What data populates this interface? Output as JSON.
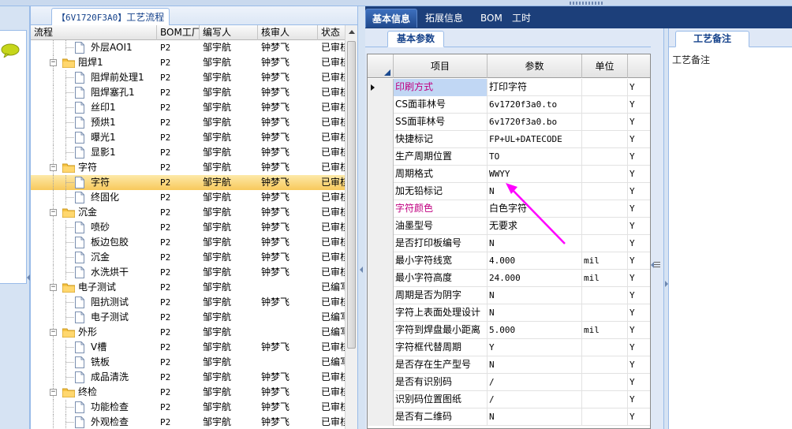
{
  "tree_panel": {
    "tab_code": "【6V1720F3A0】",
    "tab_title": "工艺流程",
    "columns": {
      "name": "流程",
      "bom": "BOM工厂",
      "author": "编写人",
      "reviewer": "核审人",
      "status": "状态"
    },
    "rows": [
      {
        "name": "外层AOI1",
        "bom": "P2",
        "author": "邹宇航",
        "reviewer": "钟梦飞",
        "status": "已审核",
        "level": 2,
        "type": "doc"
      },
      {
        "name": "阻焊1",
        "bom": "P2",
        "author": "邹宇航",
        "reviewer": "钟梦飞",
        "status": "已审核",
        "level": 1,
        "type": "folder"
      },
      {
        "name": "阻焊前处理1",
        "bom": "P2",
        "author": "邹宇航",
        "reviewer": "钟梦飞",
        "status": "已审核",
        "level": 2,
        "type": "doc"
      },
      {
        "name": "阻焊塞孔1",
        "bom": "P2",
        "author": "邹宇航",
        "reviewer": "钟梦飞",
        "status": "已审核",
        "level": 2,
        "type": "doc"
      },
      {
        "name": "丝印1",
        "bom": "P2",
        "author": "邹宇航",
        "reviewer": "钟梦飞",
        "status": "已审核",
        "level": 2,
        "type": "doc"
      },
      {
        "name": "预烘1",
        "bom": "P2",
        "author": "邹宇航",
        "reviewer": "钟梦飞",
        "status": "已审核",
        "level": 2,
        "type": "doc"
      },
      {
        "name": "曝光1",
        "bom": "P2",
        "author": "邹宇航",
        "reviewer": "钟梦飞",
        "status": "已审核",
        "level": 2,
        "type": "doc"
      },
      {
        "name": "显影1",
        "bom": "P2",
        "author": "邹宇航",
        "reviewer": "钟梦飞",
        "status": "已审核",
        "level": 2,
        "type": "doc"
      },
      {
        "name": "字符",
        "bom": "P2",
        "author": "邹宇航",
        "reviewer": "钟梦飞",
        "status": "已审核",
        "level": 1,
        "type": "folder"
      },
      {
        "name": "字符",
        "bom": "P2",
        "author": "邹宇航",
        "reviewer": "钟梦飞",
        "status": "已审核",
        "level": 2,
        "type": "doc",
        "selected": true
      },
      {
        "name": "终固化",
        "bom": "P2",
        "author": "邹宇航",
        "reviewer": "钟梦飞",
        "status": "已审核",
        "level": 2,
        "type": "doc"
      },
      {
        "name": "沉金",
        "bom": "P2",
        "author": "邹宇航",
        "reviewer": "钟梦飞",
        "status": "已审核",
        "level": 1,
        "type": "folder"
      },
      {
        "name": "喷砂",
        "bom": "P2",
        "author": "邹宇航",
        "reviewer": "钟梦飞",
        "status": "已审核",
        "level": 2,
        "type": "doc"
      },
      {
        "name": "板边包胶",
        "bom": "P2",
        "author": "邹宇航",
        "reviewer": "钟梦飞",
        "status": "已审核",
        "level": 2,
        "type": "doc"
      },
      {
        "name": "沉金",
        "bom": "P2",
        "author": "邹宇航",
        "reviewer": "钟梦飞",
        "status": "已审核",
        "level": 2,
        "type": "doc"
      },
      {
        "name": "水洗烘干",
        "bom": "P2",
        "author": "邹宇航",
        "reviewer": "钟梦飞",
        "status": "已审核",
        "level": 2,
        "type": "doc"
      },
      {
        "name": "电子测试",
        "bom": "P2",
        "author": "邹宇航",
        "reviewer": "",
        "status": "已编写",
        "level": 1,
        "type": "folder"
      },
      {
        "name": "阻抗测试",
        "bom": "P2",
        "author": "邹宇航",
        "reviewer": "钟梦飞",
        "status": "已审核",
        "level": 2,
        "type": "doc"
      },
      {
        "name": "电子测试",
        "bom": "P2",
        "author": "邹宇航",
        "reviewer": "",
        "status": "已编写",
        "level": 2,
        "type": "doc"
      },
      {
        "name": "外形",
        "bom": "P2",
        "author": "邹宇航",
        "reviewer": "",
        "status": "已编写",
        "level": 1,
        "type": "folder"
      },
      {
        "name": "V槽",
        "bom": "P2",
        "author": "邹宇航",
        "reviewer": "钟梦飞",
        "status": "已审核",
        "level": 2,
        "type": "doc"
      },
      {
        "name": "铣板",
        "bom": "P2",
        "author": "邹宇航",
        "reviewer": "",
        "status": "已编写",
        "level": 2,
        "type": "doc"
      },
      {
        "name": "成品清洗",
        "bom": "P2",
        "author": "邹宇航",
        "reviewer": "钟梦飞",
        "status": "已审核",
        "level": 2,
        "type": "doc"
      },
      {
        "name": "终检",
        "bom": "P2",
        "author": "邹宇航",
        "reviewer": "钟梦飞",
        "status": "已审核",
        "level": 1,
        "type": "folder"
      },
      {
        "name": "功能检查",
        "bom": "P2",
        "author": "邹宇航",
        "reviewer": "钟梦飞",
        "status": "已审核",
        "level": 2,
        "type": "doc"
      },
      {
        "name": "外观检查",
        "bom": "P2",
        "author": "邹宇航",
        "reviewer": "钟梦飞",
        "status": "已审核",
        "level": 2,
        "type": "doc"
      }
    ]
  },
  "main_tabs": [
    {
      "label": "基本信息",
      "active": true
    },
    {
      "label": "拓展信息",
      "active": false
    },
    {
      "label": "BOM",
      "active": false
    },
    {
      "label": "工时",
      "active": false
    }
  ],
  "params_panel": {
    "sub_tab": "基本参数",
    "columns": {
      "name": "项目",
      "value": "参数",
      "unit": "单位"
    },
    "rows": [
      {
        "name": "印刷方式",
        "value": "打印字符",
        "unit": "",
        "flag": "Y",
        "highlight": true,
        "current": true
      },
      {
        "name": "CS面菲林号",
        "value": "6v1720f3a0.to",
        "unit": "",
        "flag": "Y"
      },
      {
        "name": "SS面菲林号",
        "value": "6v1720f3a0.bo",
        "unit": "",
        "flag": "Y"
      },
      {
        "name": "快捷标记",
        "value": "FP+UL+DATECODE",
        "unit": "",
        "flag": "Y"
      },
      {
        "name": "生产周期位置",
        "value": "TO",
        "unit": "",
        "flag": "Y"
      },
      {
        "name": "周期格式",
        "value": "WWYY",
        "unit": "",
        "flag": "Y"
      },
      {
        "name": "加无铅标记",
        "value": "N",
        "unit": "",
        "flag": "Y"
      },
      {
        "name": "字符颜色",
        "value": "白色字符",
        "unit": "",
        "flag": "Y",
        "highlight": true
      },
      {
        "name": "油墨型号",
        "value": "无要求",
        "unit": "",
        "flag": "Y"
      },
      {
        "name": "是否打印板编号",
        "value": "N",
        "unit": "",
        "flag": "Y"
      },
      {
        "name": "最小字符线宽",
        "value": "4.000",
        "unit": "mil",
        "flag": "Y"
      },
      {
        "name": "最小字符高度",
        "value": "24.000",
        "unit": "mil",
        "flag": "Y"
      },
      {
        "name": "周期是否为阴字",
        "value": "N",
        "unit": "",
        "flag": "Y"
      },
      {
        "name": "字符上表面处理设计",
        "value": "N",
        "unit": "",
        "flag": "Y"
      },
      {
        "name": "字符到焊盘最小距离",
        "value": "5.000",
        "unit": "mil",
        "flag": "Y"
      },
      {
        "name": "字符框代替周期",
        "value": "Y",
        "unit": "",
        "flag": "Y"
      },
      {
        "name": "是否存在生产型号",
        "value": "N",
        "unit": "",
        "flag": "Y"
      },
      {
        "name": "是否有识别码",
        "value": "/",
        "unit": "",
        "flag": "Y"
      },
      {
        "name": "识别码位置图纸",
        "value": "/",
        "unit": "",
        "flag": "Y"
      },
      {
        "name": "是否有二维码",
        "value": "N",
        "unit": "",
        "flag": "Y"
      }
    ]
  },
  "notes_panel": {
    "tab": "工艺备注",
    "label": "工艺备注"
  },
  "colors": {
    "highlight_text": "#c00080",
    "annotation_arrow": "#ff00ff",
    "selection": "#f8c95b",
    "tab_bar": "#1c3f7a"
  }
}
